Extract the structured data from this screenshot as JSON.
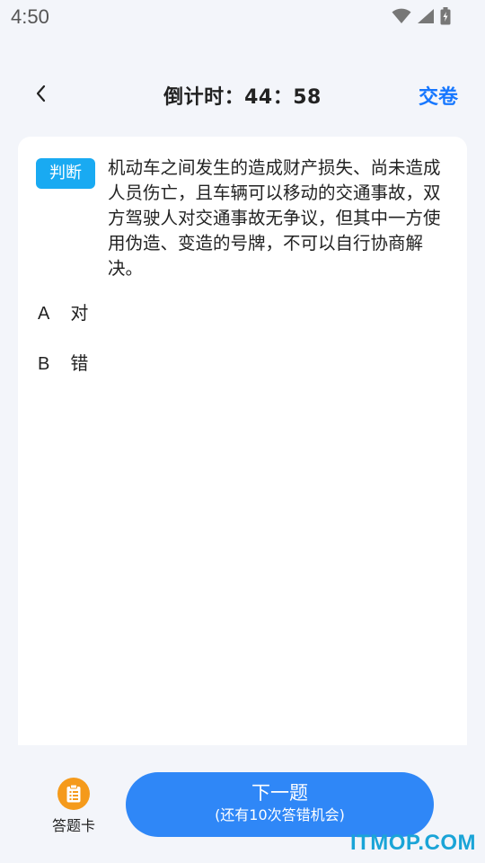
{
  "status_bar": {
    "time": "4:50",
    "icons": [
      "wifi-icon",
      "signal-icon",
      "battery-icon"
    ]
  },
  "header": {
    "title": "倒计时：44：58",
    "submit_label": "交卷"
  },
  "question": {
    "type_badge": "判断",
    "text": "机动车之间发生的造成财产损失、尚未造成人员伤亡，且车辆可以移动的交通事故，双方驾驶人对交通事故无争议，但其中一方使用伪造、变造的号牌，不可以自行协商解决。",
    "options": [
      {
        "letter": "A",
        "text": "对"
      },
      {
        "letter": "B",
        "text": "错"
      }
    ]
  },
  "bottom": {
    "answer_card_label": "答题卡",
    "next_label": "下一题",
    "next_sub": "(还有10次答错机会)"
  },
  "watermark": "ITMOP.COM",
  "colors": {
    "accent": "#1677ff",
    "badge": "#19aaf2",
    "next_button": "#2f87f7",
    "answer_card_icon": "#f59a1b",
    "watermark": "#1aa4d7"
  }
}
